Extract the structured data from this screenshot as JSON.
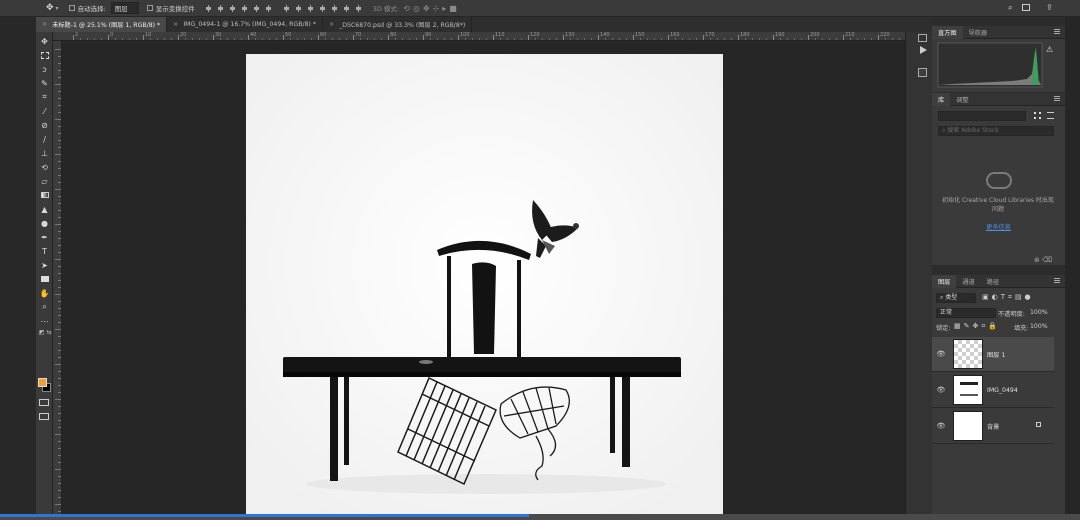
{
  "options_bar": {
    "auto_select_label": "自动选择:",
    "auto_select_value": "图层",
    "show_transform_label": "显示变换控件",
    "mode_3d_label": "3D 模式:"
  },
  "tabs": [
    {
      "label": "未标题-1 @ 25.1% (图层 1, RGB/8) *",
      "active": true
    },
    {
      "label": "IMG_0494-1 @ 16.7% (IMG_0494, RGB/8) *",
      "active": false
    },
    {
      "label": "_DSC6870.psd @ 33.3% (图层 2, RGB/8*)",
      "active": false
    }
  ],
  "ruler_labels": [
    "2",
    "0",
    "10",
    "20",
    "30",
    "40",
    "50",
    "60",
    "70",
    "80",
    "90",
    "100",
    "110",
    "120",
    "130",
    "140",
    "150",
    "160",
    "170",
    "180",
    "190",
    "200",
    "210",
    "220",
    "230"
  ],
  "histogram_panel": {
    "tabs": [
      "直方图",
      "导航器"
    ]
  },
  "library_panel": {
    "tabs": [
      "库",
      "调整"
    ],
    "search_placeholder": "搜索 Adobe Stock",
    "init_message": "初始化 Creative Cloud Libraries 时出现问题",
    "more_info_link": "更多信息"
  },
  "layers_panel": {
    "tabs": [
      "图层",
      "通道",
      "路径"
    ],
    "filter_kind": "类型",
    "blend_mode": "正常",
    "opacity_label": "不透明度:",
    "opacity_value": "100%",
    "lock_label": "锁定:",
    "fill_label": "填充:",
    "fill_value": "100%",
    "layers": [
      {
        "name": "图层 1",
        "selected": true
      },
      {
        "name": "IMG_0494",
        "selected": false
      },
      {
        "name": "背景",
        "selected": false
      }
    ]
  },
  "progress": {
    "fraction": 0.49
  },
  "colors": {
    "foreground": "#f0a030",
    "background": "#000000",
    "accent": "#2e76d6"
  }
}
